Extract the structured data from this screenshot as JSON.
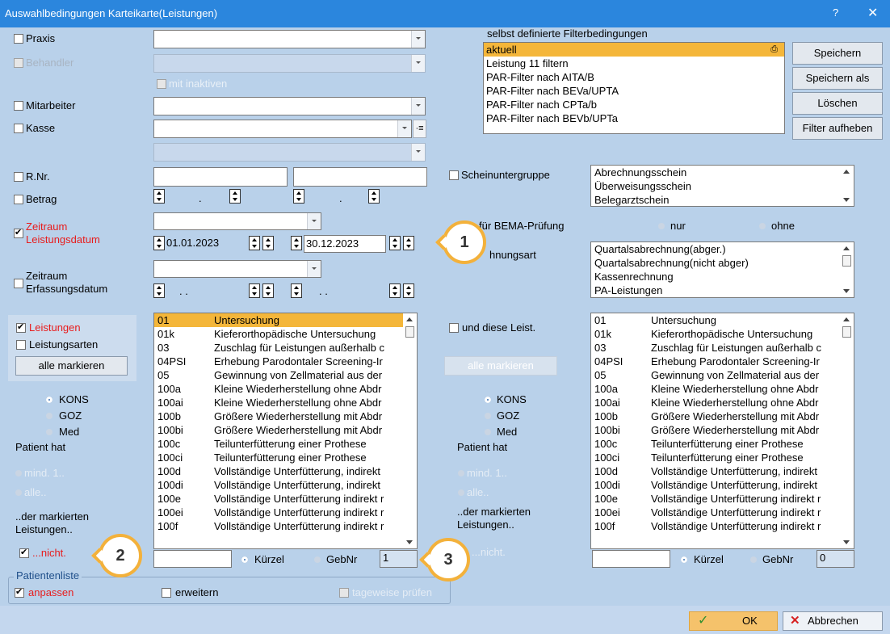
{
  "window": {
    "title": "Auswahlbedingungen Karteikarte(Leistungen)",
    "help": "?",
    "close": "✕"
  },
  "left": {
    "praxis": "Praxis",
    "behandler": "Behandler",
    "mit_inaktiven": "mit inaktiven",
    "mitarbeiter": "Mitarbeiter",
    "kasse": "Kasse",
    "rnr": "R.Nr.",
    "betrag": "Betrag",
    "zeitraum_l1": "Zeitraum",
    "zeitraum_l2": "Leistungsdatum",
    "date_from": "01.01.2023",
    "date_to": "30.12.2023",
    "zeitraum_e1": "Zeitraum",
    "zeitraum_e2": "Erfassungsdatum",
    "dot": ".",
    "dots": ". ."
  },
  "filters": {
    "label": "selbst definierte Filterbedingungen",
    "items": [
      "aktuell",
      "Leistung 11 filtern",
      "PAR-Filter nach AITA/B",
      "PAR-Filter nach BEVa/UPTA",
      "PAR-Filter nach CPTa/b",
      "PAR-Filter nach BEVb/UPTa"
    ]
  },
  "buttons": {
    "speichern": "Speichern",
    "speichern_als": "Speichern als",
    "loeschen": "Löschen",
    "filter_aufheben": "Filter aufheben",
    "alle_markieren": "alle markieren",
    "ok": "OK",
    "abbrechen": "Abbrechen"
  },
  "schein": {
    "label": "Scheinuntergruppe",
    "items": [
      "Abrechnungsschein",
      "Überweisungsschein",
      "Belegarztschein"
    ],
    "bema": "für BEMA-Prüfung",
    "nur": "nur",
    "ohne": "ohne",
    "abrechnungsart": "hnungsart",
    "art_items": [
      "Quartalsabrechnung(abger.)",
      "Quartalsabrechnung(nicht abger)",
      "Kassenrechnung",
      "PA-Leistungen"
    ]
  },
  "leistungen": {
    "leistungen": "Leistungen",
    "leistungsarten": "Leistungsarten",
    "und_diese": "und diese Leist.",
    "kons": "KONS",
    "goz": "GOZ",
    "med": "Med",
    "patient_hat": "Patient hat",
    "mind": "mind. 1..",
    "alle": "alle..",
    "markierten1": "..der markierten",
    "markierten2": "Leistungen..",
    "nicht": "...nicht.",
    "kuerzel": "Kürzel",
    "gebnr": "GebNr",
    "count_left": "1",
    "count_right": "0",
    "rows": [
      {
        "code": "01",
        "desc": "Untersuchung"
      },
      {
        "code": "01k",
        "desc": "Kieferorthopädische Untersuchung"
      },
      {
        "code": "03",
        "desc": "Zuschlag für Leistungen außerhalb c"
      },
      {
        "code": "04PSI",
        "desc": "Erhebung Parodontaler Screening-Ir"
      },
      {
        "code": "05",
        "desc": "Gewinnung von Zellmaterial aus der"
      },
      {
        "code": "100a",
        "desc": "Kleine Wiederherstellung ohne Abdr"
      },
      {
        "code": "100ai",
        "desc": "Kleine Wiederherstellung ohne Abdr"
      },
      {
        "code": "100b",
        "desc": "Größere Wiederherstellung mit Abdr"
      },
      {
        "code": "100bi",
        "desc": "Größere Wiederherstellung mit Abdr"
      },
      {
        "code": "100c",
        "desc": "Teilunterfütterung einer Prothese"
      },
      {
        "code": "100ci",
        "desc": "Teilunterfütterung einer Prothese"
      },
      {
        "code": "100d",
        "desc": "Vollständige Unterfütterung, indirekt"
      },
      {
        "code": "100di",
        "desc": "Vollständige Unterfütterung, indirekt"
      },
      {
        "code": "100e",
        "desc": "Vollständige Unterfütterung indirekt r"
      },
      {
        "code": "100ei",
        "desc": "Vollständige Unterfütterung indirekt r"
      },
      {
        "code": "100f",
        "desc": "Vollständige Unterfütterung indirekt r"
      }
    ]
  },
  "patientenliste": {
    "title": "Patientenliste",
    "anpassen": "anpassen",
    "erweitern": "erweitern",
    "tageweise": "tageweise prüfen"
  },
  "callouts": [
    "1",
    "2",
    "3"
  ],
  "colors": {
    "titlebar": "#2b86dd",
    "bg": "#b9d1ea",
    "selection": "#f4b63a",
    "callout": "#f3b13b",
    "red": "#e81c1c"
  }
}
